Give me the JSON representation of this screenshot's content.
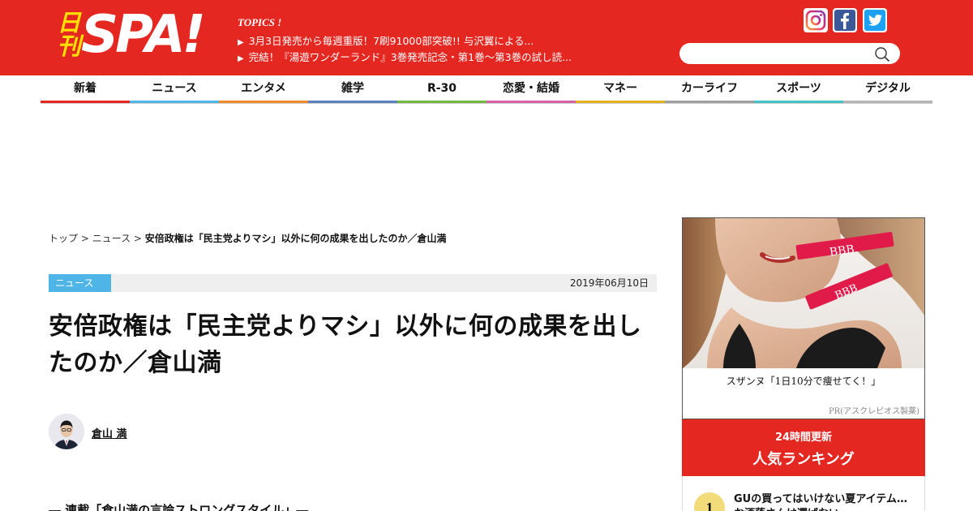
{
  "header": {
    "logo_kan": "日刊",
    "logo_spa": "SPA!",
    "topics_title": "TOPICS !",
    "topics": [
      "3月3日発売から毎週重版！7刷91000部突破!! 与沢翼による...",
      "完結！『湯遊ワンダーランド』3巻発売記念・第1巻～第3巻の試し読..."
    ],
    "search_placeholder": "",
    "colors": {
      "brand": "#e52721",
      "logo_yellow": "#ffe000"
    }
  },
  "nav": [
    {
      "label": "新着",
      "color": "#e52721"
    },
    {
      "label": "ニュース",
      "color": "#4fb5e7"
    },
    {
      "label": "エンタメ",
      "color": "#ef8b2c"
    },
    {
      "label": "雑学",
      "color": "#5b7fbf"
    },
    {
      "label": "R-30",
      "color": "#73b843"
    },
    {
      "label": "恋愛・結婚",
      "color": "#d760a8"
    },
    {
      "label": "マネー",
      "color": "#e3b221"
    },
    {
      "label": "カーライフ",
      "color": "#a0a0a0"
    },
    {
      "label": "スポーツ",
      "color": "#45c1c8"
    },
    {
      "label": "デジタル",
      "color": "#b5b5b5"
    }
  ],
  "breadcrumb": {
    "top": "トップ",
    "sep1": " > ",
    "category": "ニュース",
    "sep2": " > ",
    "current": "安倍政権は「民主党よりマシ」以外に何の成果を出したのか／倉山満"
  },
  "article": {
    "category": "ニュース",
    "date": "2019年06月10日",
    "title": "安倍政権は「民主党よりマシ」以外に何の成果を出したのか／倉山満",
    "author": "倉山 満",
    "series": "― 連載「倉山満の言論ストロングスタイル」―"
  },
  "sidebar": {
    "ad_caption": "スザンヌ「1日10分で痩せてく！」",
    "ad_pr": "PR(アスクレピオス製薬)",
    "ad_product_label": "BBB",
    "ranking_sub": "24時間更新",
    "ranking_title": "人気ランキング",
    "ranking_items": [
      {
        "rank": "1",
        "text": "GUの買ってはいけない夏アイテム…お洒落さんは選ばない"
      }
    ]
  }
}
